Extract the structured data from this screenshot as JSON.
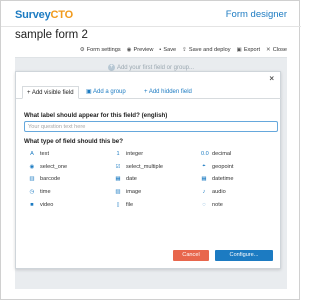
{
  "header": {
    "logo_main": "Survey",
    "logo_accent": "CTO",
    "app_title": "Form designer"
  },
  "form_name": "sample form 2",
  "toolbar": [
    {
      "icon": "gear-icon",
      "glyph": "⚙",
      "label": "Form settings"
    },
    {
      "icon": "eye-icon",
      "glyph": "◉",
      "label": "Preview"
    },
    {
      "icon": "save-icon",
      "glyph": "▪",
      "label": "Save"
    },
    {
      "icon": "upload-icon",
      "glyph": "⇪",
      "label": "Save and deploy"
    },
    {
      "icon": "export-icon",
      "glyph": "▣",
      "label": "Export"
    },
    {
      "icon": "close-icon",
      "glyph": "✕",
      "label": "Close"
    }
  ],
  "canvas": {
    "add_field_text": "Add your first field or group..."
  },
  "modal": {
    "close_glyph": "×",
    "tabs": [
      {
        "label": "+ Add visible field",
        "active": true
      },
      {
        "label": "Add a group",
        "active": false
      },
      {
        "label": "+ Add hidden field",
        "active": false
      }
    ],
    "question_label": "What label should appear for this field? (english)",
    "question_placeholder": "Your question text here",
    "question_value": "",
    "type_label": "What type of field should this be?",
    "field_types": [
      {
        "icon": "text-icon",
        "glyph": "A",
        "label": "text"
      },
      {
        "icon": "integer-icon",
        "glyph": "1",
        "label": "integer"
      },
      {
        "icon": "decimal-icon",
        "glyph": "0.0",
        "label": "decimal"
      },
      {
        "icon": "select-one-icon",
        "glyph": "◉",
        "label": "select_one"
      },
      {
        "icon": "select-multiple-icon",
        "glyph": "☑",
        "label": "select_multiple"
      },
      {
        "icon": "geopoint-icon",
        "glyph": "⌖",
        "label": "geopoint"
      },
      {
        "icon": "barcode-icon",
        "glyph": "▥",
        "label": "barcode"
      },
      {
        "icon": "date-icon",
        "glyph": "▦",
        "label": "date"
      },
      {
        "icon": "datetime-icon",
        "glyph": "▦",
        "label": "datetime"
      },
      {
        "icon": "time-icon",
        "glyph": "◷",
        "label": "time"
      },
      {
        "icon": "image-icon",
        "glyph": "▨",
        "label": "image"
      },
      {
        "icon": "audio-icon",
        "glyph": "♪",
        "label": "audio"
      },
      {
        "icon": "video-icon",
        "glyph": "■",
        "label": "video"
      },
      {
        "icon": "file-icon",
        "glyph": "▯",
        "label": "file"
      },
      {
        "icon": "note-icon",
        "glyph": "◌",
        "label": "note"
      }
    ],
    "cancel_label": "Cancel",
    "configure_label": "Configure..."
  },
  "colors": {
    "brand_blue": "#1c7bc2",
    "brand_orange": "#f19a1c",
    "cancel_red": "#e8664c"
  }
}
